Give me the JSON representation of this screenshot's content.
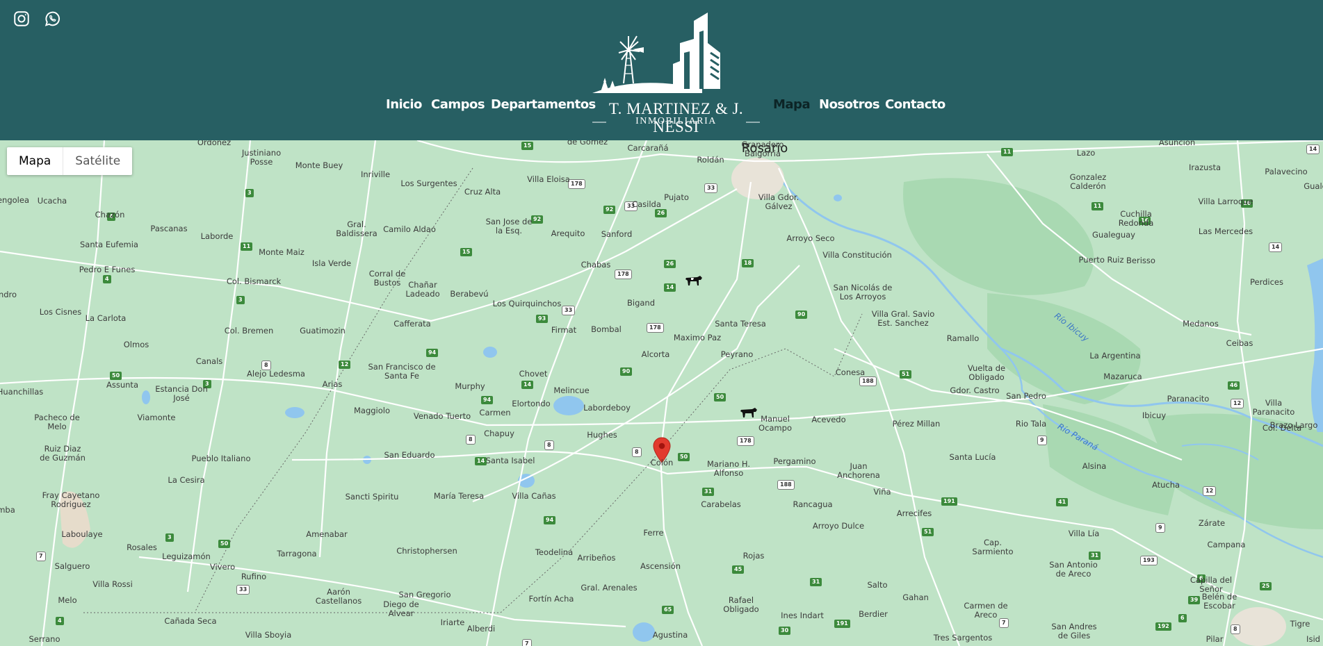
{
  "header": {
    "background_color": "#275f63",
    "social": [
      {
        "name": "instagram-icon"
      },
      {
        "name": "whatsapp-icon"
      }
    ],
    "nav_left": [
      "Inicio",
      "Campos",
      "Departamentos"
    ],
    "nav_right": [
      "Mapa",
      "Nosotros",
      "Contacto"
    ],
    "active": "Mapa",
    "logo": {
      "name": "T. MARTINEZ & J. NESSI",
      "subtitle": "INMOBILIARIA"
    }
  },
  "map": {
    "toggle": {
      "map_label": "Mapa",
      "satellite_label": "Satélite",
      "selected": "Mapa"
    },
    "land_color": "#bfe3c6",
    "water_color": "#90c6ee",
    "road_color": "#ffffff",
    "marker_color": "#e23b2e",
    "rivers": [
      "Río Ibicuy",
      "Río Paraná"
    ],
    "places": [
      "Rosario",
      "Ordoñez",
      "Justiniano Posse",
      "Monte Buey",
      "Inriville",
      "Los Surgentes",
      "Cruz Alta",
      "Villa Eloisa",
      "Carcarañá",
      "Roldán",
      "Granadero Baigorria",
      "Lazo",
      "Asunción",
      "Irazusta",
      "Gonzalez Calderón",
      "Palavecino",
      "Guale",
      "de Gomez",
      "Casilda",
      "Pujato",
      "Villa Gdor. Gálvez",
      "Villa Larroque",
      "Cuchilla Redonda",
      "Las Mercedes",
      "Ucacha",
      "engolea",
      "Chazón",
      "Pascanas",
      "Laborde",
      "Gral. Baldissera",
      "Camilo Aldao",
      "San Jose de la Esq.",
      "Arequito",
      "Sanford",
      "Arroyo Seco",
      "Gualeguay",
      "Puerto Ruiz",
      "Berisso",
      "Santa Eufemia",
      "Monte Maiz",
      "Isla Verde",
      "Corral de Bustos",
      "Chañar Ladeado",
      "Berabevú",
      "Chabas",
      "Villa Constitución",
      "Perdices",
      "Pedro E Funes",
      "Col. Bismarck",
      "Los Quirquinchos",
      "Bigand",
      "San Nicolás de Los Arroyos",
      "Los Cisnes",
      "La Carlota",
      "ndro",
      "Cafferata",
      "Firmat",
      "Bombal",
      "Santa Teresa",
      "Villa Gral. Savio Est. Sanchez",
      "Ramallo",
      "Medanos",
      "Col. Bremen",
      "Guatimozin",
      "Olmos",
      "Maximo Paz",
      "Peyrano",
      "Ceibas",
      "Canals",
      "Alejo Ledesma",
      "Arias",
      "San Francisco de Santa Fe",
      "Alcorta",
      "La Argentina",
      "Vuelta de Obligado",
      "Mazaruca",
      "Conesa",
      "Chovet",
      "Assunta",
      "Estancia Don José",
      "Murphy",
      "Melincue",
      "Gdor. Castro",
      "San Pedro",
      "Paranacito",
      "Villa Paranacito",
      "Huanchillas",
      "Maggiolo",
      "Carmen",
      "Elortondo",
      "Labordeboy",
      "Ibicuy",
      "Pacheco de Melo",
      "Viamonte",
      "Venado Tuerto",
      "Manuel Ocampo",
      "Acevedo",
      "Pérez Millan",
      "Rio Tala",
      "Col. Delta",
      "Brazo Largo",
      "Chapuy",
      "Hughes",
      "Ruiz Diaz de Guzmán",
      "Pueblo Italiano",
      "San Eduardo",
      "Santa Isabel",
      "Colón",
      "Mariano H. Alfonso",
      "Pergamino",
      "Juan Anchorena",
      "Santa Lucía",
      "Alsina",
      "La Cesira",
      "Fray Cayetano Rodriguez",
      "Sancti Spiritu",
      "María Teresa",
      "Villa Cañas",
      "Viña",
      "Atucha",
      "Carabelas",
      "Rancagua",
      "Arrecifes",
      "mba",
      "Laboulaye",
      "Amenabar",
      "Zárate",
      "Ferre",
      "Arroyo Dulce",
      "Villa Lía",
      "Rosales",
      "Leguizamón",
      "Tarragona",
      "Christophersen",
      "Teodelina",
      "Campana",
      "Cap. Sarmiento",
      "Salguero",
      "Vivero",
      "Arribeños",
      "Rojas",
      "Rufino",
      "Ascensión",
      "San Antonio de Areco",
      "Villa Rossi",
      "Capilla del Señor",
      "Salto",
      "Aarón Castellanos",
      "San Gregorio",
      "Gral. Arenales",
      "Gahan",
      "Melo",
      "Diego de Alvear",
      "Fortín Acha",
      "Rafael Obligado",
      "Cañada Seca",
      "Belén de Escobar",
      "Iriarte",
      "Carmen de Areco",
      "Ines Indart",
      "Berdier",
      "Alberdi",
      "Villa Sboyia",
      "Agustina",
      "San Andres de Giles",
      "Tigre",
      "Tres Sargentos",
      "Serrano",
      "Pilar",
      "Isid"
    ]
  }
}
